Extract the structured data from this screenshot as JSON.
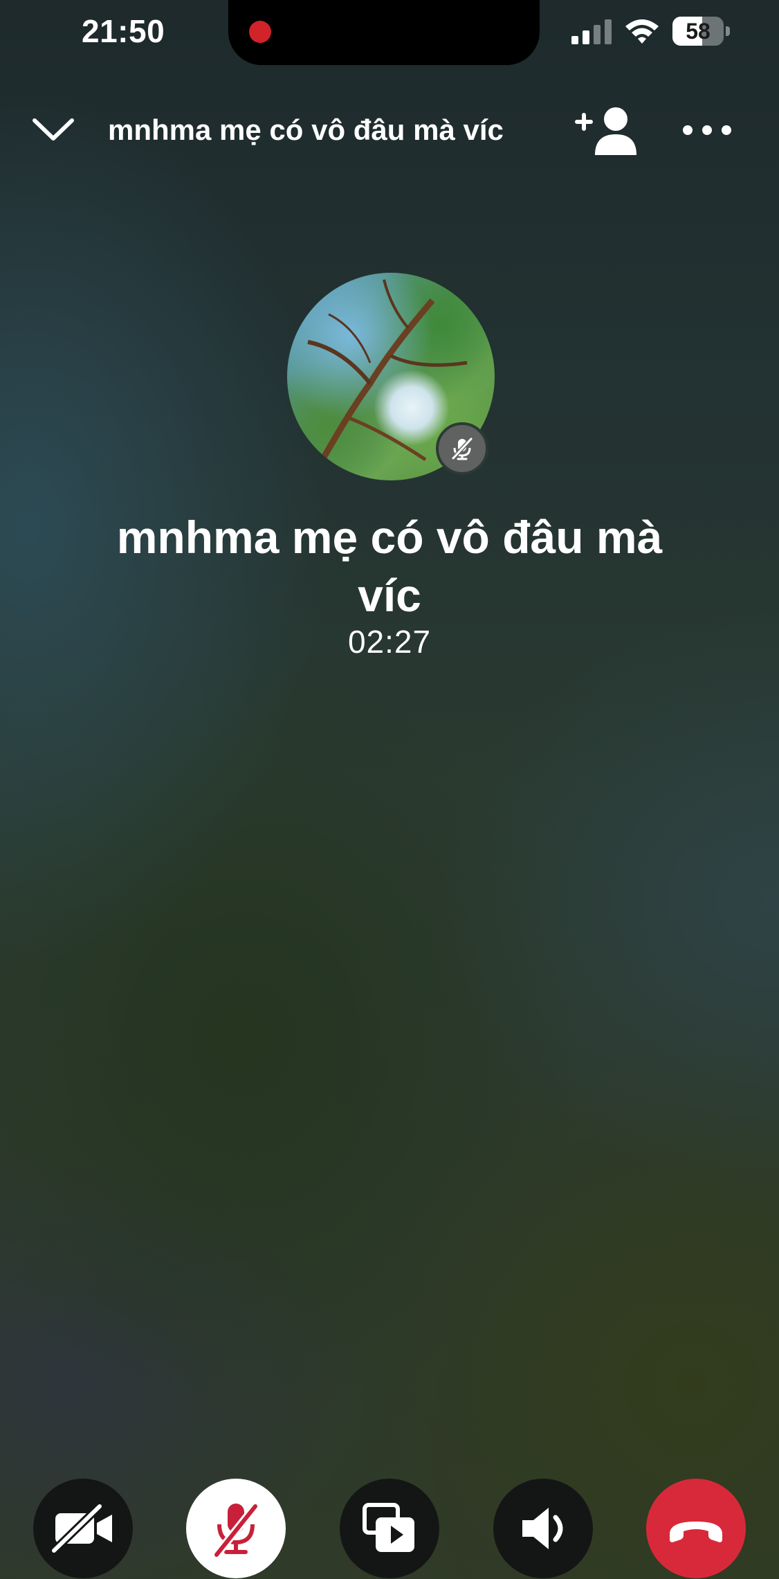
{
  "status_bar": {
    "time": "21:50",
    "battery_percent": 58,
    "battery_label": "58",
    "recording_color": "#d1232a",
    "icons": [
      "signal-bars-icon",
      "wifi-icon",
      "battery-icon"
    ]
  },
  "header": {
    "title": "mnhma mẹ có vô đâu mà víc",
    "icons": [
      "chevron-down-icon",
      "add-person-icon",
      "more-icon"
    ]
  },
  "call": {
    "name": "mnhma mẹ có vô đâu mà víc",
    "duration": "02:27",
    "participant_muted": true
  },
  "controls": [
    {
      "name": "camera-off",
      "icon": "video-off-icon",
      "active": false
    },
    {
      "name": "microphone-muted",
      "icon": "mic-off-icon",
      "active": true
    },
    {
      "name": "share-media",
      "icon": "media-share-icon",
      "active": false
    },
    {
      "name": "speaker",
      "icon": "speaker-icon",
      "active": false
    },
    {
      "name": "end-call",
      "icon": "phone-hangup-icon",
      "active": false
    }
  ],
  "colors": {
    "end_call": "#d8293a",
    "mute_active_icon": "#c8203a",
    "control_background": "#141616"
  }
}
